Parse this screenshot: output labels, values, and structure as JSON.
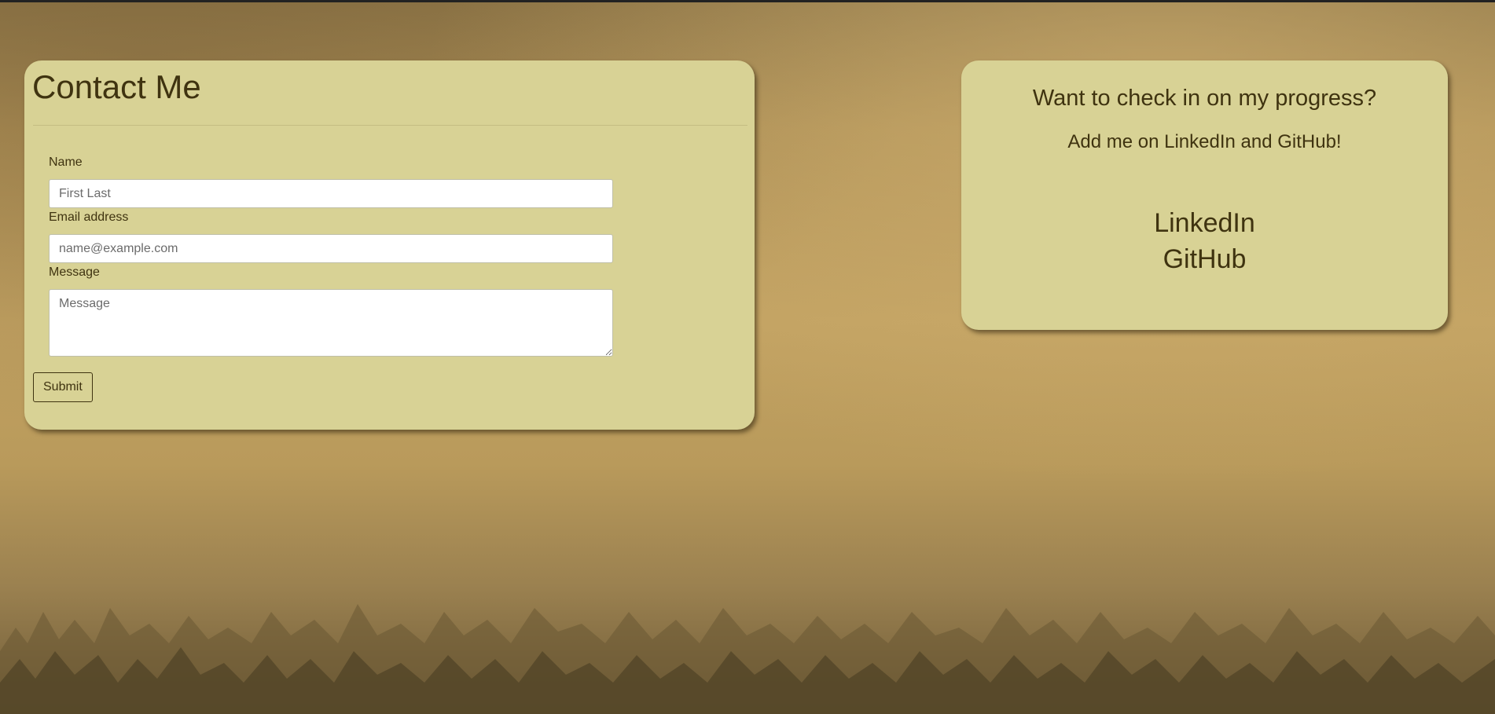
{
  "contact": {
    "title": "Contact Me",
    "name_label": "Name",
    "name_placeholder": "First Last",
    "email_label": "Email address",
    "email_placeholder": "name@example.com",
    "message_label": "Message",
    "message_placeholder": "Message",
    "submit_label": "Submit"
  },
  "social": {
    "heading": "Want to check in on my progress?",
    "subheading": "Add me on LinkedIn and GitHub!",
    "links": [
      {
        "label": "LinkedIn"
      },
      {
        "label": "GitHub"
      }
    ]
  },
  "colors": {
    "panel_bg": "#d8d295",
    "text": "#3f3310",
    "background_top": "#8f7748",
    "background_mid": "#c2a262"
  }
}
